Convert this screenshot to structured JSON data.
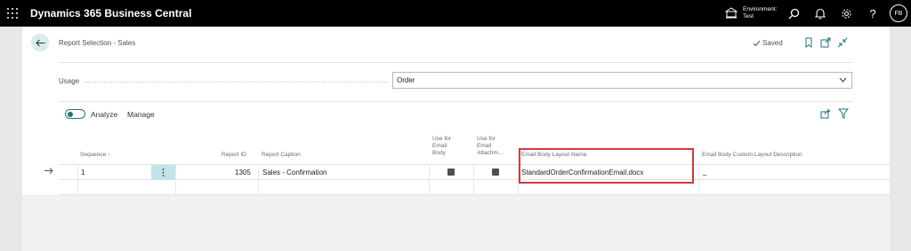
{
  "app": {
    "title": "Dynamics 365 Business Central"
  },
  "topbar": {
    "env_label": "Environment:",
    "env_value": "Test",
    "avatar_initials": "FB",
    "help_label": "?"
  },
  "header": {
    "title": "Report Selection - Sales",
    "saved_label": "Saved"
  },
  "usage": {
    "label": "Usage",
    "value": "Order"
  },
  "actions": {
    "analyze_label": "Analyze",
    "manage_label": "Manage"
  },
  "table": {
    "columns": {
      "sequence": "Sequence ↑",
      "report_id": "Report ID",
      "report_caption": "Report Caption",
      "use_email_body": [
        "Use for",
        "Email",
        "Body"
      ],
      "use_email_attach": [
        "Use for",
        "Email",
        "Attachm..."
      ],
      "email_layout_name": "Email Body Layout Name",
      "email_custom_desc": "Email Body Custom Layout Description"
    },
    "rows": [
      {
        "sequence": "1",
        "report_id": "1305",
        "report_caption": "Sales - Confirmation",
        "email_layout_name": "StandardOrderConfirmationEmail.docx",
        "email_custom_desc": "_"
      }
    ]
  },
  "colors": {
    "accent": "#1f7380",
    "highlight": "#d33a3a",
    "selected_cell": "#bfe5ea"
  }
}
